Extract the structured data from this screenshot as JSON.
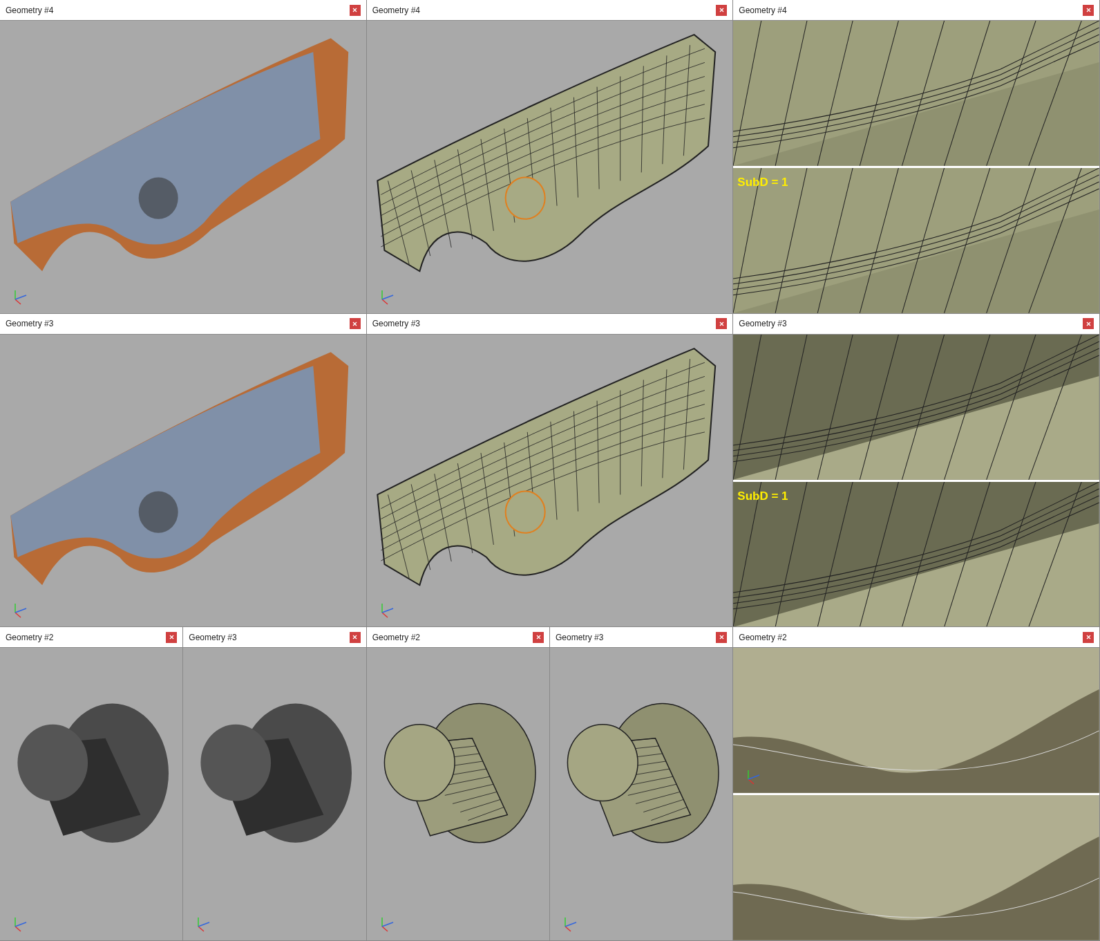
{
  "rows": [
    {
      "columns": [
        {
          "panels": [
            {
              "title": "Geometry #4",
              "views": [
                {
                  "kind": "shaded",
                  "axes": true
                }
              ]
            }
          ]
        },
        {
          "panels": [
            {
              "title": "Geometry #4",
              "views": [
                {
                  "kind": "wireframe",
                  "axes": true
                }
              ]
            }
          ]
        },
        {
          "panels": [
            {
              "title": "Geometry #4",
              "views": [
                {
                  "kind": "closeup",
                  "axes": false
                },
                {
                  "kind": "closeup",
                  "axes": false,
                  "label": "SubD = 1"
                }
              ]
            }
          ]
        }
      ]
    },
    {
      "columns": [
        {
          "panels": [
            {
              "title": "Geometry #3",
              "views": [
                {
                  "kind": "shaded",
                  "axes": true
                }
              ]
            }
          ]
        },
        {
          "panels": [
            {
              "title": "Geometry #3",
              "views": [
                {
                  "kind": "wireframe",
                  "axes": true
                }
              ]
            }
          ]
        },
        {
          "panels": [
            {
              "title": "Geometry #3",
              "views": [
                {
                  "kind": "closeup-dark",
                  "axes": false
                },
                {
                  "kind": "closeup-dark",
                  "axes": false,
                  "label": "SubD = 1"
                }
              ]
            }
          ]
        }
      ]
    },
    {
      "columns": [
        {
          "panels": [
            {
              "title": "Geometry #2",
              "views": [
                {
                  "kind": "bolt",
                  "axes": true
                }
              ]
            },
            {
              "title": "Geometry #3",
              "views": [
                {
                  "kind": "bolt",
                  "axes": true
                }
              ]
            }
          ]
        },
        {
          "panels": [
            {
              "title": "Geometry #2",
              "views": [
                {
                  "kind": "bolt-wireframe",
                  "axes": true
                }
              ]
            },
            {
              "title": "Geometry #3",
              "views": [
                {
                  "kind": "bolt-wireframe",
                  "axes": true
                }
              ]
            }
          ]
        },
        {
          "panels": [
            {
              "title": "Geometry #2",
              "views": [
                {
                  "kind": "smooth",
                  "axes": true
                },
                {
                  "kind": "smooth",
                  "axes": false
                }
              ]
            }
          ]
        }
      ]
    }
  ]
}
